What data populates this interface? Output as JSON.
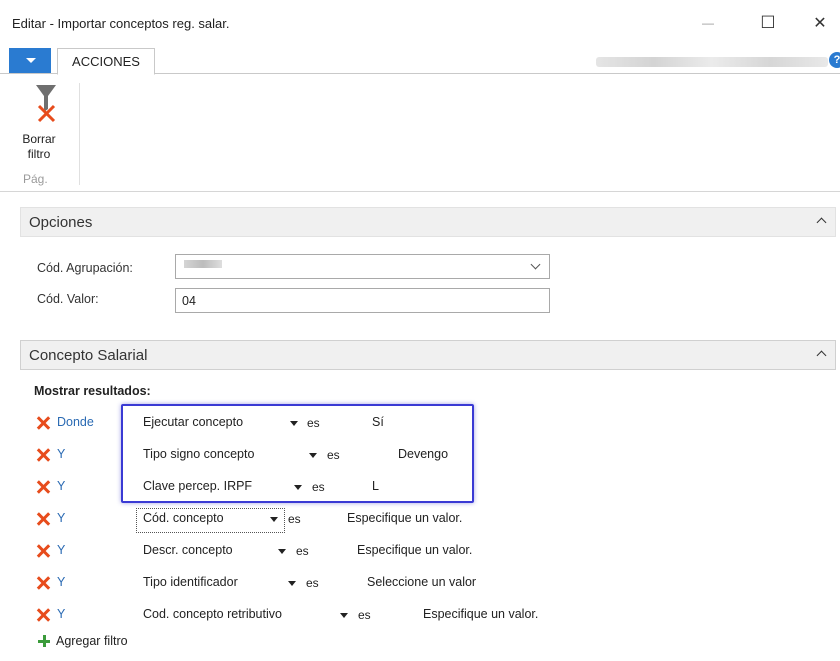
{
  "window": {
    "title": "Editar - Importar conceptos reg. salar.",
    "minimize_glyph": "—",
    "maximize_glyph": "☐",
    "close_glyph": "✕"
  },
  "tabs": {
    "actions_label": "ACCIONES",
    "help_glyph": "?"
  },
  "ribbon": {
    "button_label": "Borrar filtro",
    "button_icon": "clear-filter-icon",
    "group_label": "Pág."
  },
  "options": {
    "header": "Opciones",
    "agrupacion_label": "Cód. Agrupación:",
    "valor_label": "Cód. Valor:",
    "valor_value": "04"
  },
  "concept": {
    "header": "Concepto Salarial",
    "show_results": "Mostrar resultados:",
    "filters": [
      {
        "connector": "Donde",
        "field": "Ejecutar concepto",
        "op": "es",
        "value": "Sí"
      },
      {
        "connector": "Y",
        "field": "Tipo signo concepto",
        "op": "es",
        "value": "Devengo"
      },
      {
        "connector": "Y",
        "field": "Clave percep. IRPF",
        "op": "es",
        "value": "L"
      },
      {
        "connector": "Y",
        "field": "Cód. concepto",
        "op": "es",
        "value": "Especifique un valor."
      },
      {
        "connector": "Y",
        "field": "Descr. concepto",
        "op": "es",
        "value": "Especifique un valor."
      },
      {
        "connector": "Y",
        "field": "Tipo identificador",
        "op": "es",
        "value": "Seleccione un valor"
      },
      {
        "connector": "Y",
        "field": "Cod. concepto retributivo",
        "op": "es",
        "value": "Especifique un valor."
      }
    ],
    "add_filter": "Agregar filtro"
  },
  "colors": {
    "accent": "#2a7bd1",
    "remove_icon": "#e74c1c",
    "add_icon": "#3b9b3b",
    "highlight_box": "#3a3ad4",
    "connector_text": "#2a6ab3"
  }
}
